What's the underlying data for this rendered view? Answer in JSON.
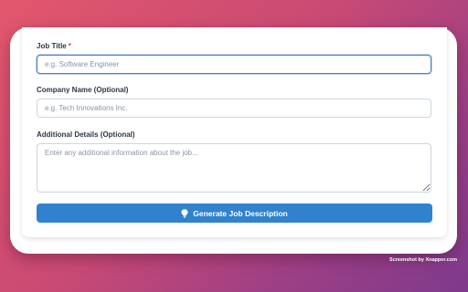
{
  "form": {
    "job_title": {
      "label": "Job Title",
      "required_mark": "*",
      "placeholder": "e.g. Software Engineer",
      "value": ""
    },
    "company_name": {
      "label": "Company Name (Optional)",
      "placeholder": "e.g. Tech Innovations Inc.",
      "value": ""
    },
    "additional_details": {
      "label": "Additional Details (Optional)",
      "placeholder": "Enter any additional information about the job...",
      "value": ""
    },
    "generate_button": {
      "label": "Generate Job Description",
      "icon": "lightbulb-icon"
    }
  },
  "watermark": "Screenshot by Xnapper.com",
  "colors": {
    "primary_button": "#3182ce",
    "focus_border": "#4a7fc1",
    "required": "#e53e3e",
    "background_start": "#e2576c",
    "background_end": "#7e3a8c"
  }
}
